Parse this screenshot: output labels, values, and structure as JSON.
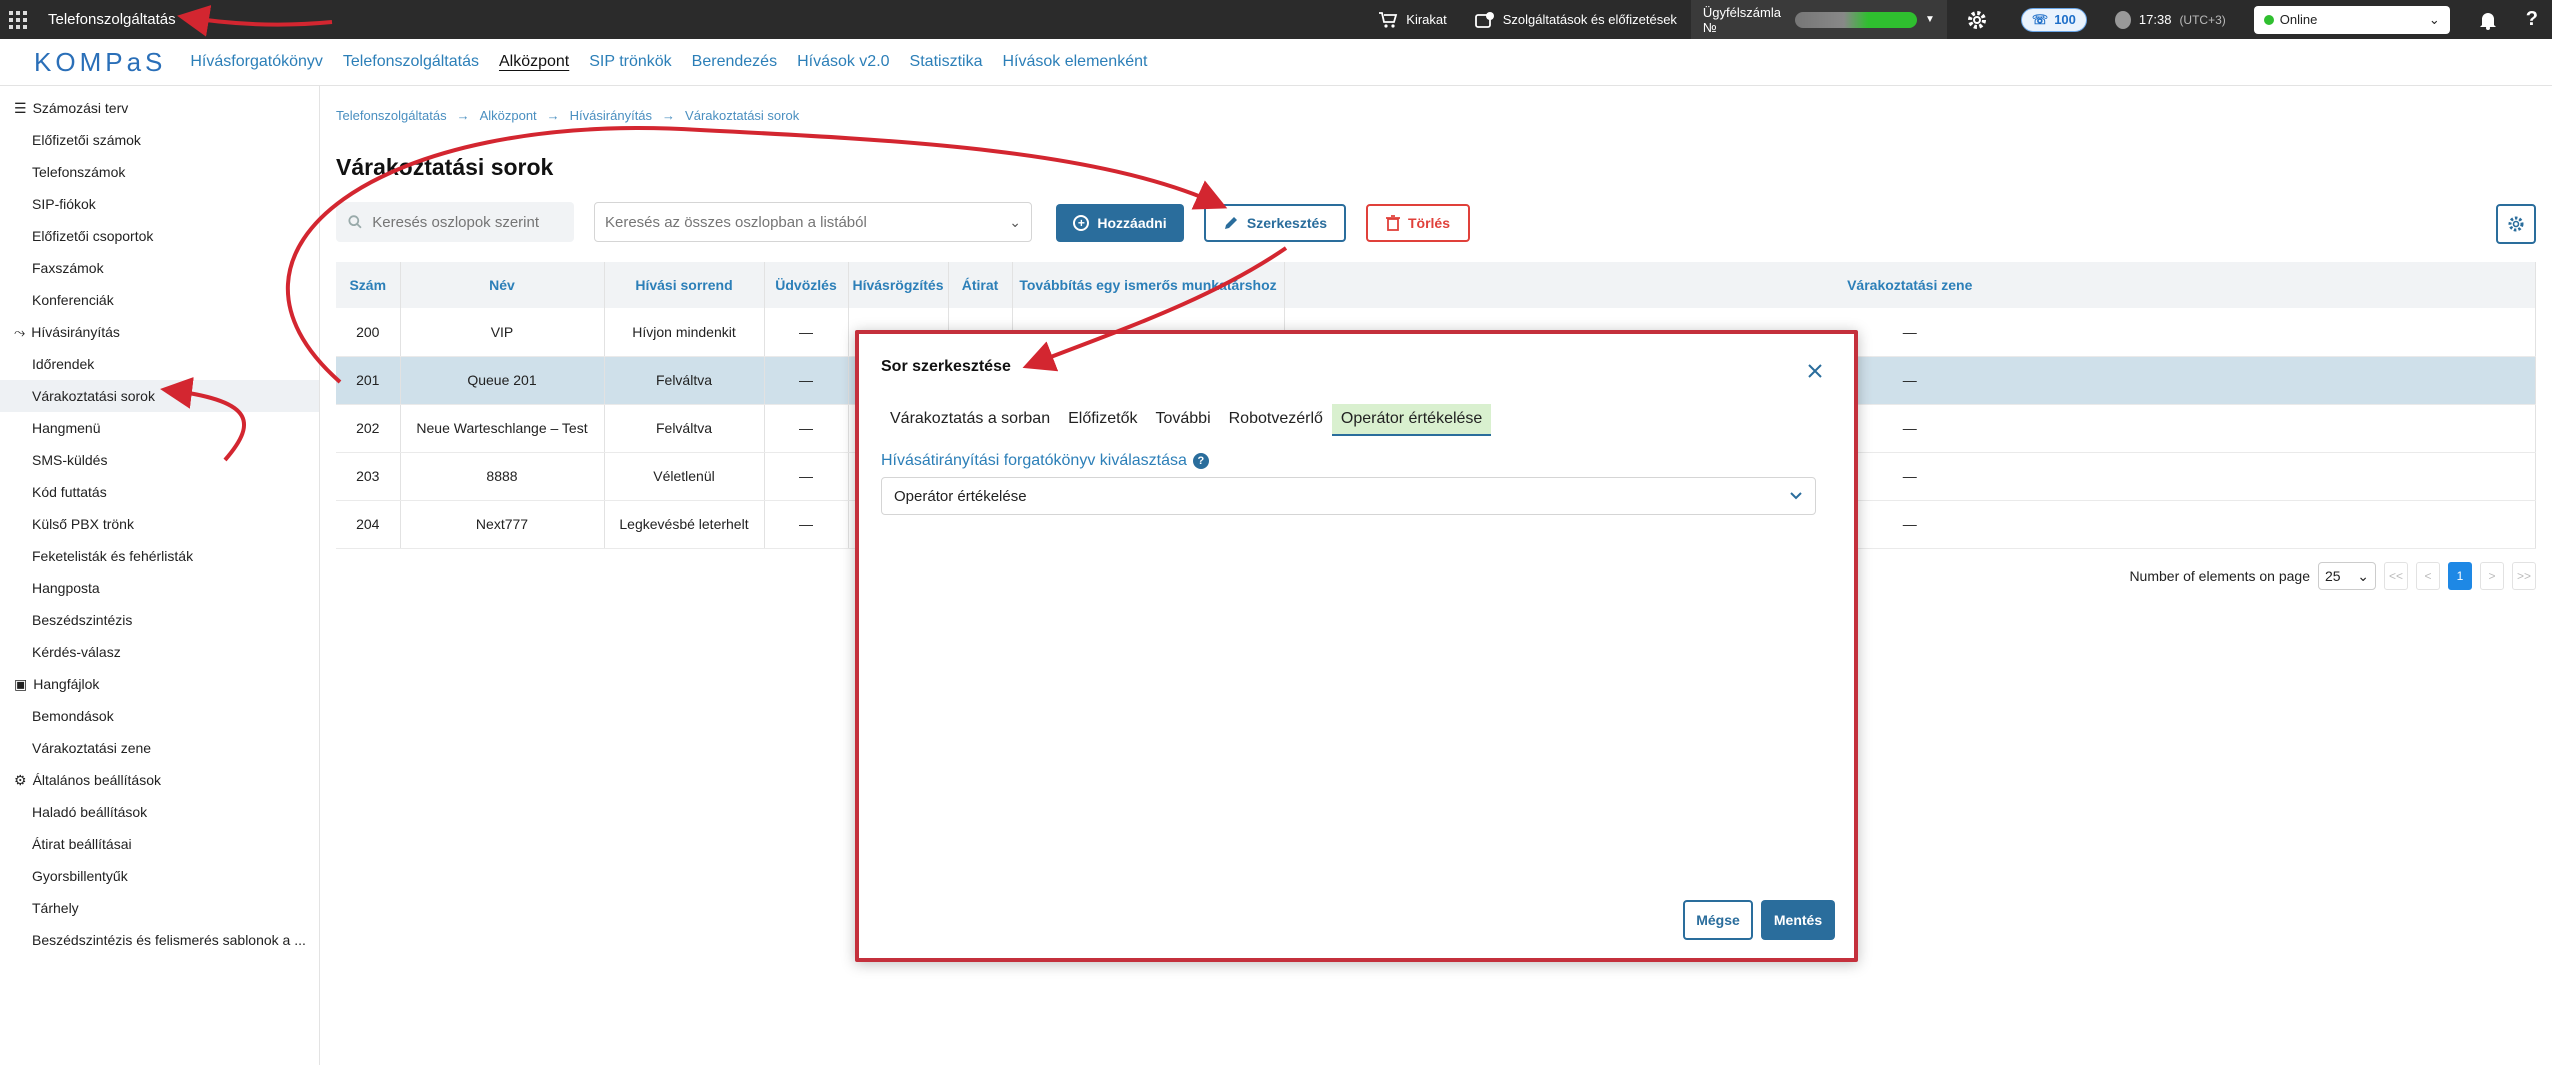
{
  "topbar": {
    "title": "Telefonszolgáltatás",
    "showcase": "Kirakat",
    "services": "Szolgáltatások és előfizetések",
    "account_label": "Ügyfélszámla №",
    "phone_count": "100",
    "time": "17:38",
    "timezone": "(UTC+3)",
    "status": "Online"
  },
  "nav": {
    "logo": "KOMPaS",
    "links": [
      "Hívásforgatókönyv",
      "Telefonszolgáltatás",
      "Alközpont",
      "SIP trönkök",
      "Berendezés",
      "Hívások v2.0",
      "Statisztika",
      "Hívások elemenként"
    ]
  },
  "sidebar": {
    "group1": "Számozási terv",
    "g1_items": [
      "Előfizetői számok",
      "Telefonszámok",
      "SIP-fiókok",
      "Előfizetői csoportok",
      "Faxszámok",
      "Konferenciák"
    ],
    "group2": "Hívásirányítás",
    "g2_items": [
      "Időrendek",
      "Várakoztatási sorok",
      "Hangmenü",
      "SMS-küldés",
      "Kód futtatás",
      "Külső PBX trönk",
      "Feketelisták és fehérlisták",
      "Hangposta",
      "Beszédszintézis",
      "Kérdés-válasz"
    ],
    "group3": "Hangfájlok",
    "g3_items": [
      "Bemondások",
      "Várakoztatási zene"
    ],
    "group4": "Általános beállítások",
    "g4_items": [
      "Haladó beállítások",
      "Átirat beállításai",
      "Gyorsbillentyűk",
      "Tárhely",
      "Beszédszintézis és felismerés sablonok a ..."
    ]
  },
  "breadcrumb": [
    "Telefonszolgáltatás",
    "Alközpont",
    "Hívásirányítás",
    "Várakoztatási sorok"
  ],
  "page_title": "Várakoztatási sorok",
  "toolbar": {
    "search_placeholder": "Keresés oszlopok szerint",
    "global_search_placeholder": "Keresés az összes oszlopban a listából",
    "add_label": "Hozzáadni",
    "edit_label": "Szerkesztés",
    "delete_label": "Törlés"
  },
  "table": {
    "headers": [
      "Szám",
      "Név",
      "Hívási sorrend",
      "Üdvözlés",
      "Hívásrögzítés",
      "Átirat",
      "Továbbítás egy ismerős munkatárshoz",
      "Várakoztatási zene"
    ],
    "rows": [
      [
        "200",
        "VIP",
        "Hívjon mindenkit",
        "—",
        "—"
      ],
      [
        "201",
        "Queue 201",
        "Felváltva",
        "—",
        "—"
      ],
      [
        "202",
        "Neue Warteschlange – Test",
        "Felváltva",
        "—",
        "—"
      ],
      [
        "203",
        "8888",
        "Véletlenül",
        "—",
        "—"
      ],
      [
        "204",
        "Next777",
        "Legkevésbé leterhelt",
        "—",
        "—"
      ]
    ]
  },
  "pager": {
    "label": "Number of elements on page",
    "page_size": "25",
    "first": "<<",
    "prev": "<",
    "current": "1",
    "next": ">",
    "last": ">>"
  },
  "modal": {
    "title": "Sor szerkesztése",
    "tabs": [
      "Várakoztatás a sorban",
      "Előfizetők",
      "További",
      "Robotvezérlő",
      "Operátor értékelése"
    ],
    "field_label": "Hívásátirányítási forgatókönyv kiválasztása",
    "help": "?",
    "field_value": "Operátor értékelése",
    "cancel_label": "Mégse",
    "save_label": "Mentés"
  },
  "colors": {
    "accent": "#2a6d9c",
    "danger": "#e0403a",
    "annotation": "#c4303c"
  }
}
